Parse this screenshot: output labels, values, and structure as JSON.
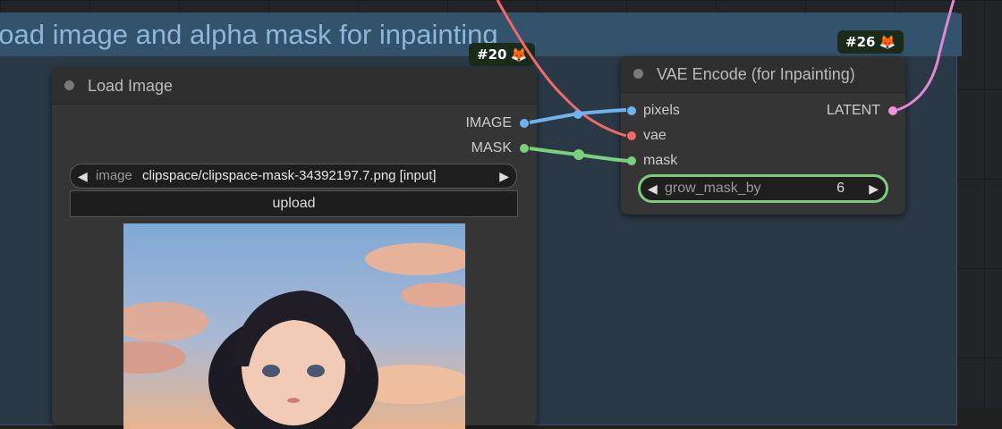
{
  "group": {
    "title": "Load image and alpha mask for inpainting"
  },
  "load_image": {
    "badge": "#20",
    "title": "Load Image",
    "outputs": [
      "IMAGE",
      "MASK"
    ],
    "widget_label": "image",
    "widget_value": "clipspace/clipspace-mask-34392197.7.png [input]",
    "upload_label": "upload"
  },
  "vae_encode": {
    "badge": "#26",
    "title": "VAE Encode (for Inpainting)",
    "inputs": [
      "pixels",
      "vae",
      "mask"
    ],
    "output": "LATENT",
    "widget_label": "grow_mask_by",
    "widget_value": "6"
  },
  "colors": {
    "image_slot": "#6fb2f0",
    "mask_slot": "#7cd07c",
    "vae_slot": "#f06a6a",
    "latent_slot": "#f090e0",
    "vae_link": "#f06a6a",
    "latent_link": "#e088d8"
  },
  "icons": {
    "badge_icon": "fox-icon",
    "left_arrow": "triangle-left-icon",
    "right_arrow": "triangle-right-icon"
  }
}
